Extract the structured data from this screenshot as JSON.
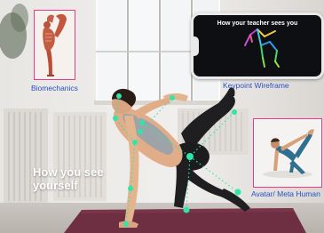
{
  "overlay": {
    "main_caption_line1": "How you see",
    "main_caption_line2": "yourself",
    "biomechanics_label": "Biomechanics",
    "keypoint_label": "Keypoint Wireframe",
    "phone_title": "How your teacher sees you",
    "avatar_label": "Avatar/ Meta Human"
  },
  "colors": {
    "keypoint": "#2ee6a8",
    "inset_border": "#e83a8c",
    "label_blue": "#2a4fc4",
    "mat": "#6e2f43"
  }
}
